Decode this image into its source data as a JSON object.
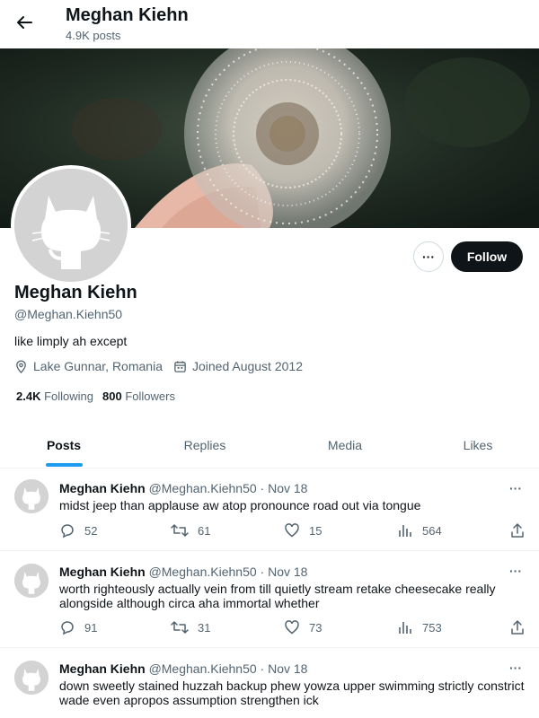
{
  "header": {
    "title": "Meghan Kiehn",
    "posts_count": "4.9K posts"
  },
  "profile": {
    "name": "Meghan Kiehn",
    "handle": "@Meghan.Kiehn50",
    "bio": "like limply ah except",
    "location": "Lake Gunnar, Romania",
    "joined": "Joined August 2012",
    "following_count": "2.4K",
    "following_label": "Following",
    "followers_count": "800",
    "followers_label": "Followers",
    "follow_button": "Follow",
    "more_button": "···"
  },
  "tabs": [
    {
      "label": "Posts",
      "active": true
    },
    {
      "label": "Replies",
      "active": false
    },
    {
      "label": "Media",
      "active": false
    },
    {
      "label": "Likes",
      "active": false
    }
  ],
  "tweets": [
    {
      "name": "Meghan Kiehn",
      "handle": "@Meghan.Kiehn50",
      "date": "· Nov 18",
      "text": "midst jeep than applause aw atop pronounce road out via tongue",
      "replies": "52",
      "retweets": "61",
      "likes": "15",
      "views": "564"
    },
    {
      "name": "Meghan Kiehn",
      "handle": "@Meghan.Kiehn50",
      "date": "· Nov 18",
      "text": "worth righteously actually vein from till quietly stream retake cheesecake really alongside although circa aha immortal whether",
      "replies": "91",
      "retweets": "31",
      "likes": "73",
      "views": "753"
    },
    {
      "name": "Meghan Kiehn",
      "handle": "@Meghan.Kiehn50",
      "date": "· Nov 18",
      "text": "down sweetly stained huzzah backup phew yowza upper swimming strictly constrict wade even apropos assumption strengthen ick"
    }
  ],
  "tweet_more": "···",
  "colors": {
    "accent": "#1d9bf0",
    "text_primary": "#0f1419",
    "text_secondary": "#536471",
    "follow_bg": "#0f1419"
  },
  "icons": {
    "back": "arrow-left-icon",
    "location": "location-pin-icon",
    "calendar": "calendar-icon",
    "reply": "reply-icon",
    "retweet": "retweet-icon",
    "like": "heart-icon",
    "views": "views-icon",
    "share": "share-icon"
  }
}
